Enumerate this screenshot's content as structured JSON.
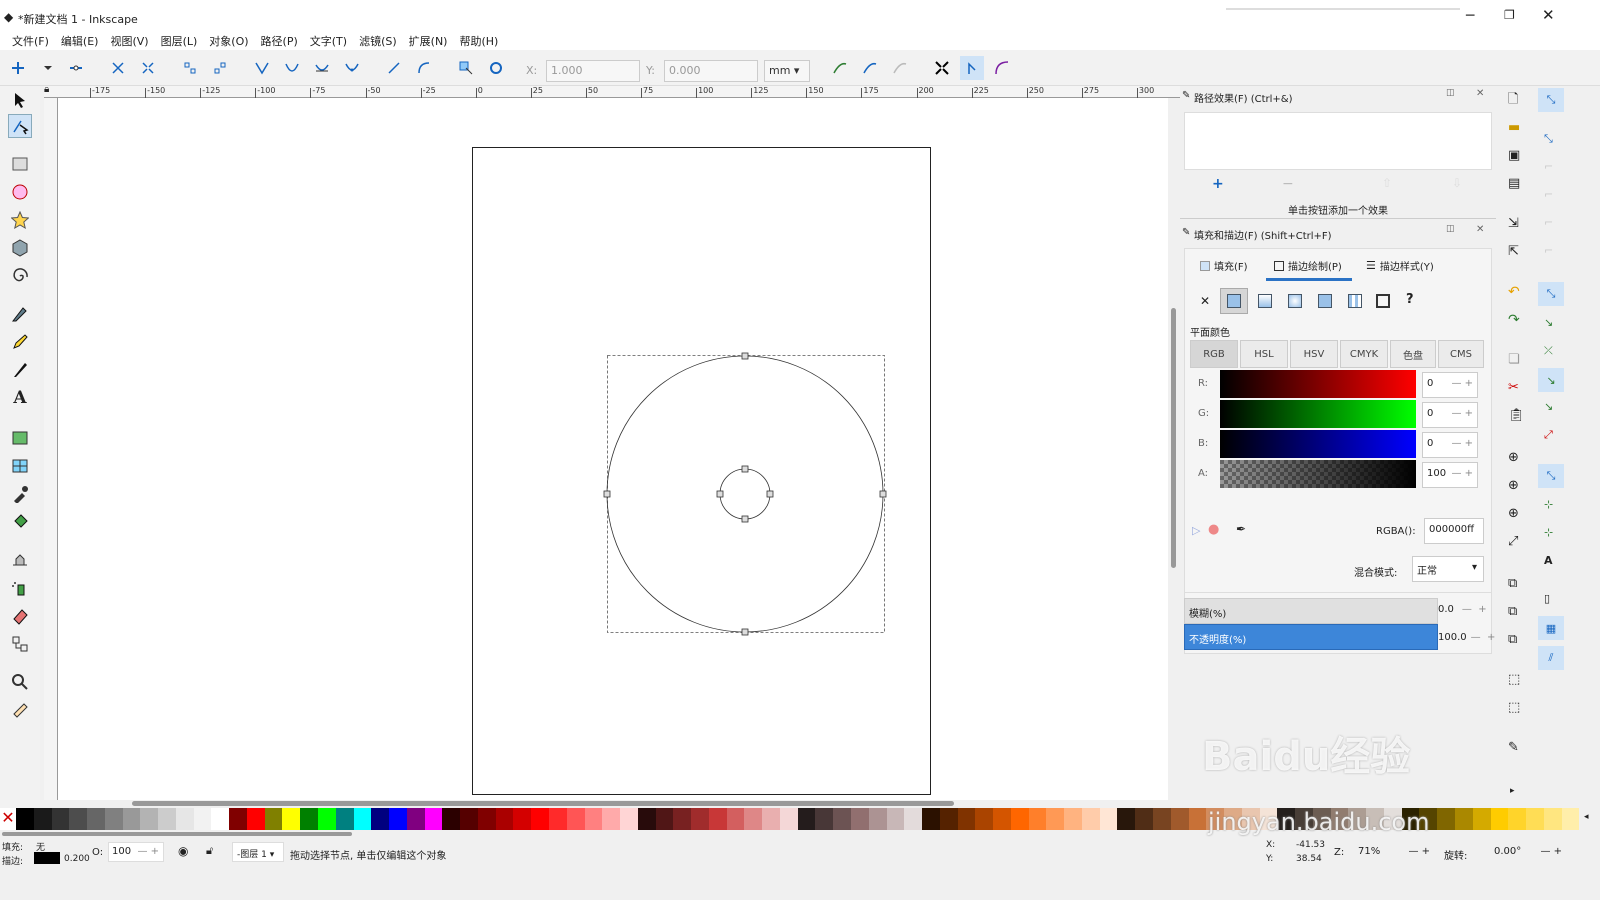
{
  "window": {
    "title": "*新建文档 1 - Inkscape"
  },
  "menu": [
    "文件(F)",
    "编辑(E)",
    "视图(V)",
    "图层(L)",
    "对象(O)",
    "路径(P)",
    "文字(T)",
    "滤镜(S)",
    "扩展(N)",
    "帮助(H)"
  ],
  "toolbar": {
    "x_label": "X:",
    "x_value": "1.000",
    "y_label": "Y:",
    "y_value": "0.000",
    "unit": "mm"
  },
  "ruler": {
    "ticks": [
      "-175",
      "-150",
      "-125",
      "-100",
      "-75",
      "-50",
      "-25",
      "0",
      "25",
      "50",
      "75",
      "100",
      "125",
      "150",
      "175",
      "200",
      "225",
      "250",
      "275",
      "300"
    ]
  },
  "lpe_panel": {
    "title": "路径效果(F) (Ctrl+&)",
    "hint": "单击按钮添加一个效果"
  },
  "fill_stroke": {
    "title": "填充和描边(F) (Shift+Ctrl+F)",
    "tabs": [
      "填充(F)",
      "描边绘制(P)",
      "描边样式(Y)"
    ],
    "active_tab": 1,
    "paint_label": "平面颜色",
    "color_modes": [
      "RGB",
      "HSL",
      "HSV",
      "CMYK",
      "色盘",
      "CMS"
    ],
    "channels": [
      {
        "label": "R:",
        "value": "0"
      },
      {
        "label": "G:",
        "value": "0"
      },
      {
        "label": "B:",
        "value": "0"
      },
      {
        "label": "A:",
        "value": "100"
      }
    ],
    "rgba_label": "RGBA():",
    "rgba_value": "000000ff",
    "blend_label": "混合模式:",
    "blend_value": "正常",
    "blur_label": "模糊(%)",
    "blur_value": "0.0",
    "opacity_label": "不透明度(%)",
    "opacity_value": "100.0"
  },
  "status": {
    "fill_label": "填充:",
    "fill_value": "无",
    "stroke_label": "描边:",
    "stroke_width": "0.200",
    "opacity_label": "O:",
    "opacity_value": "100",
    "layer": "-图层 1",
    "message": "拖动选择节点, 单击仅编辑这个对象",
    "x_label": "X:",
    "x_value": "-41.53",
    "y_label": "Y:",
    "y_value": "38.54",
    "zoom_label": "Z:",
    "zoom_value": "71%",
    "rotate_label": "旋转:",
    "rotate_value": "0.00°"
  },
  "watermark": {
    "brand": "Baidu经验",
    "url": "jingyan.baidu.com"
  },
  "palette": [
    "#000000",
    "#1a1a1a",
    "#333333",
    "#4d4d4d",
    "#666666",
    "#808080",
    "#999999",
    "#b3b3b3",
    "#cccccc",
    "#e6e6e6",
    "#f2f2f2",
    "#ffffff",
    "#800000",
    "#ff0000",
    "#808000",
    "#ffff00",
    "#008000",
    "#00ff00",
    "#008080",
    "#00ffff",
    "#000080",
    "#0000ff",
    "#800080",
    "#ff00ff",
    "#2b0000",
    "#550000",
    "#800000",
    "#aa0000",
    "#d40000",
    "#ff0000",
    "#ff2a2a",
    "#ff5555",
    "#ff8080",
    "#ffaaaa",
    "#ffd5d5",
    "#280b0b",
    "#501616",
    "#782121",
    "#a02c2c",
    "#c83737",
    "#d35f5f",
    "#de8787",
    "#e9afaf",
    "#f4d7d7",
    "#241c1c",
    "#483737",
    "#6c5353",
    "#916f6f",
    "#ac9393",
    "#c8b7b7",
    "#e3dbdb",
    "#2b1100",
    "#552200",
    "#803300",
    "#aa4400",
    "#d45500",
    "#ff6600",
    "#ff7f2a",
    "#ff9955",
    "#ffb380",
    "#ffccaa",
    "#ffe6d5",
    "#28170b",
    "#502d16",
    "#784421",
    "#a05a2c",
    "#c87137",
    "#d38d5f",
    "#deaa87",
    "#e9c6af",
    "#f4e3d7",
    "#241f1c",
    "#483e37",
    "#6c5d53",
    "#917c6f",
    "#ac9d93",
    "#c8beb7",
    "#e3dedb",
    "#2b2200",
    "#554400",
    "#806600",
    "#aa8800",
    "#d4aa00",
    "#ffcc00",
    "#ffd42a",
    "#ffdd55",
    "#ffe680",
    "#ffeeaa"
  ]
}
